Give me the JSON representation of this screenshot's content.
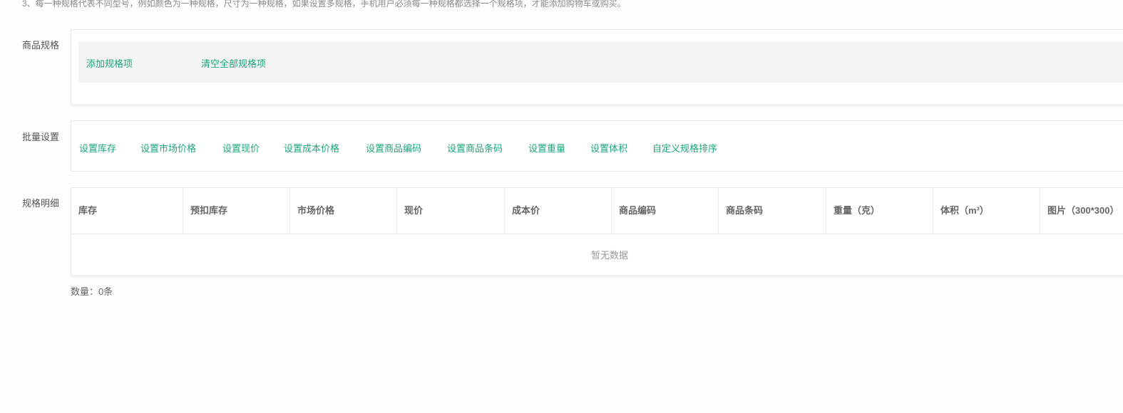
{
  "tip": "3、每一种规格代表不同型号，例如颜色为一种规格，尺寸为一种规格，如果设置多规格，手机用户必须每一种规格都选择一个规格项，才能添加购物车或购买。",
  "spec": {
    "label": "商品规格",
    "add": "添加规格项",
    "clear": "清空全部规格项"
  },
  "batch": {
    "label": "批量设置",
    "items": [
      "设置库存",
      "设置市场价格",
      "设置现价",
      "设置成本价格",
      "设置商品编码",
      "设置商品条码",
      "设置重量",
      "设置体积",
      "自定义规格排序"
    ]
  },
  "detail": {
    "label": "规格明细",
    "columns": [
      "库存",
      "预扣库存",
      "市场价格",
      "现价",
      "成本价",
      "商品编码",
      "商品条码",
      "重量（克）",
      "体积（m³）",
      "图片（300*300）"
    ],
    "empty": "暂无数据",
    "count_prefix": "数量：",
    "count": "0条"
  }
}
